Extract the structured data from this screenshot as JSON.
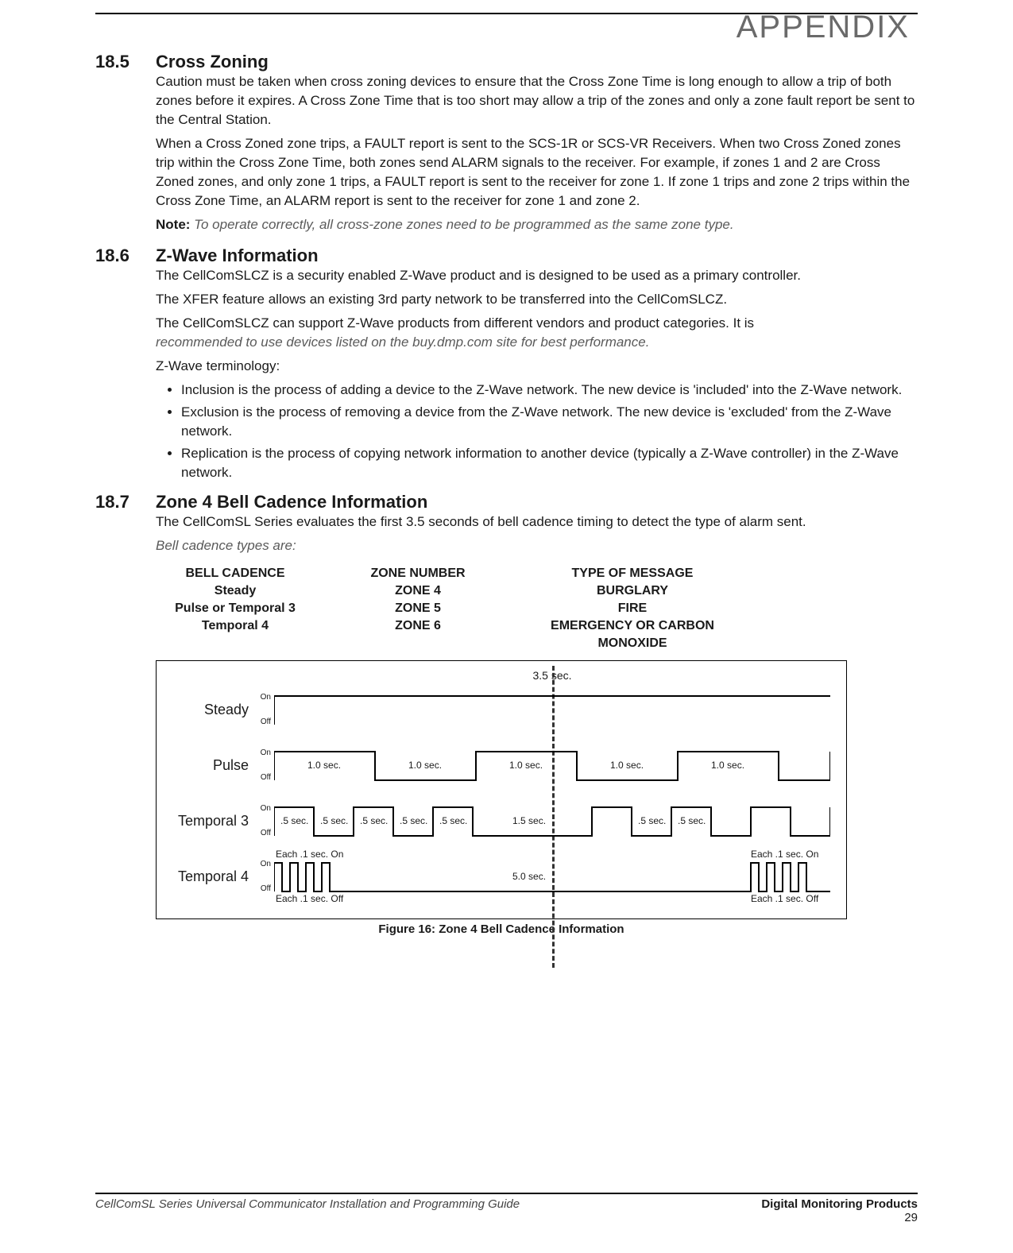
{
  "header": {
    "appendix": "APPENDIX"
  },
  "s185": {
    "num": "18.5",
    "title": "Cross Zoning",
    "p1": "Caution must be taken when cross zoning devices to ensure that the Cross Zone Time is long enough to allow a trip of both zones before it expires. A Cross Zone Time that is too short may allow a trip of the zones and only a zone fault report be sent to the Central Station.",
    "p2": "When a Cross Zoned zone trips, a FAULT report is sent to the SCS-1R or SCS-VR Receivers. When two Cross Zoned zones trip within the Cross Zone Time, both zones send ALARM signals to the receiver. For example, if zones 1 and 2 are Cross Zoned zones, and only zone 1 trips, a FAULT report is sent to the receiver for zone 1. If zone 1 trips and zone 2 trips within the Cross Zone Time, an ALARM report is sent to the receiver for zone 1 and zone 2.",
    "note_label": "Note: ",
    "note": "To operate correctly, all cross-zone zones need to be programmed as the same zone type."
  },
  "s186": {
    "num": "18.6",
    "title": "Z-Wave Information",
    "p1": "The CellComSLCZ is a security enabled Z-Wave product and is designed to be used as a primary controller.",
    "p2": "The XFER feature allows an existing 3rd party network to be transferred into the CellComSLCZ.",
    "p3a": "The CellComSLCZ can support Z-Wave products from different vendors and product categories. It is",
    "p3b": "recommended to use devices listed on the buy.dmp.com site for best performance.",
    "p4": "Z-Wave terminology:",
    "b1": "Inclusion is the process of adding a device to the Z-Wave network. The new device is 'included' into the Z-Wave network.",
    "b2": "Exclusion is the process of removing a device from the Z-Wave network. The new device is 'excluded' from the Z-Wave network.",
    "b3": "Replication is the process of copying network information to another device (typically a Z-Wave controller) in the Z-Wave network."
  },
  "s187": {
    "num": "18.7",
    "title": "Zone 4 Bell Cadence Information",
    "p1": "The CellComSL Series evaluates the first 3.5 seconds of bell cadence timing to detect the type of alarm sent.",
    "p2": "Bell cadence types are:",
    "table": {
      "headers": [
        "BELL CADENCE",
        "ZONE NUMBER",
        "TYPE OF MESSAGE"
      ],
      "rows": [
        [
          "Steady",
          "ZONE 4",
          "BURGLARY"
        ],
        [
          "Pulse or Temporal 3",
          "ZONE 5",
          "FIRE"
        ],
        [
          "Temporal 4",
          "ZONE 6",
          "EMERGENCY OR CARBON MONOXIDE"
        ]
      ]
    }
  },
  "figure": {
    "top_label": "3.5 sec.",
    "rows": {
      "steady": {
        "label": "Steady",
        "on": "On",
        "off": "Off"
      },
      "pulse": {
        "label": "Pulse",
        "on": "On",
        "off": "Off",
        "times": [
          "1.0 sec.",
          "1.0 sec.",
          "1.0 sec.",
          "1.0 sec.",
          "1.0 sec."
        ]
      },
      "temp3": {
        "label": "Temporal 3",
        "on": "On",
        "off": "Off",
        "times": [
          ".5 sec.",
          ".5 sec.",
          ".5 sec.",
          ".5 sec.",
          ".5 sec.",
          "1.5 sec.",
          ".5 sec.",
          ".5 sec."
        ]
      },
      "temp4": {
        "label": "Temporal 4",
        "on": "On",
        "off": "Off",
        "left_top": "Each .1 sec. On",
        "left_bot": "Each .1 sec. Off",
        "mid": "5.0 sec.",
        "right_top": "Each .1 sec. On",
        "right_bot": "Each .1 sec. Off"
      }
    },
    "caption": "Figure 16: Zone 4 Bell Cadence Information"
  },
  "chart_data": {
    "type": "timing-diagram",
    "title": "Zone 4 Bell Cadence Information",
    "evaluation_window_sec": 3.5,
    "unit": "seconds",
    "signals": [
      {
        "name": "Steady",
        "levels": [
          "On",
          "Off"
        ],
        "pattern": [
          {
            "level": "On",
            "duration": null
          }
        ],
        "note": "continuous On"
      },
      {
        "name": "Pulse",
        "levels": [
          "On",
          "Off"
        ],
        "pattern_repeat": [
          {
            "level": "On",
            "duration": 1.0
          },
          {
            "level": "Off",
            "duration": 1.0
          }
        ],
        "labeled_durations": [
          1.0,
          1.0,
          1.0,
          1.0,
          1.0
        ]
      },
      {
        "name": "Temporal 3",
        "levels": [
          "On",
          "Off"
        ],
        "pattern_repeat": [
          {
            "level": "On",
            "duration": 0.5
          },
          {
            "level": "Off",
            "duration": 0.5
          },
          {
            "level": "On",
            "duration": 0.5
          },
          {
            "level": "Off",
            "duration": 0.5
          },
          {
            "level": "On",
            "duration": 0.5
          },
          {
            "level": "Off",
            "duration": 1.5
          }
        ],
        "labeled_durations": [
          0.5,
          0.5,
          0.5,
          0.5,
          0.5,
          1.5,
          0.5,
          0.5
        ]
      },
      {
        "name": "Temporal 4",
        "levels": [
          "On",
          "Off"
        ],
        "pattern_repeat": [
          {
            "level": "On",
            "duration": 0.1
          },
          {
            "level": "Off",
            "duration": 0.1
          },
          {
            "level": "On",
            "duration": 0.1
          },
          {
            "level": "Off",
            "duration": 0.1
          },
          {
            "level": "On",
            "duration": 0.1
          },
          {
            "level": "Off",
            "duration": 0.1
          },
          {
            "level": "On",
            "duration": 0.1
          },
          {
            "level": "Off",
            "duration": 5.0
          }
        ],
        "labeled_durations": {
          "each_on": 0.1,
          "each_off": 0.1,
          "gap": 5.0
        }
      }
    ]
  },
  "footer": {
    "left": "CellComSL Series Universal Communicator Installation and Programming Guide",
    "right": "Digital Monitoring Products",
    "page": "29"
  }
}
